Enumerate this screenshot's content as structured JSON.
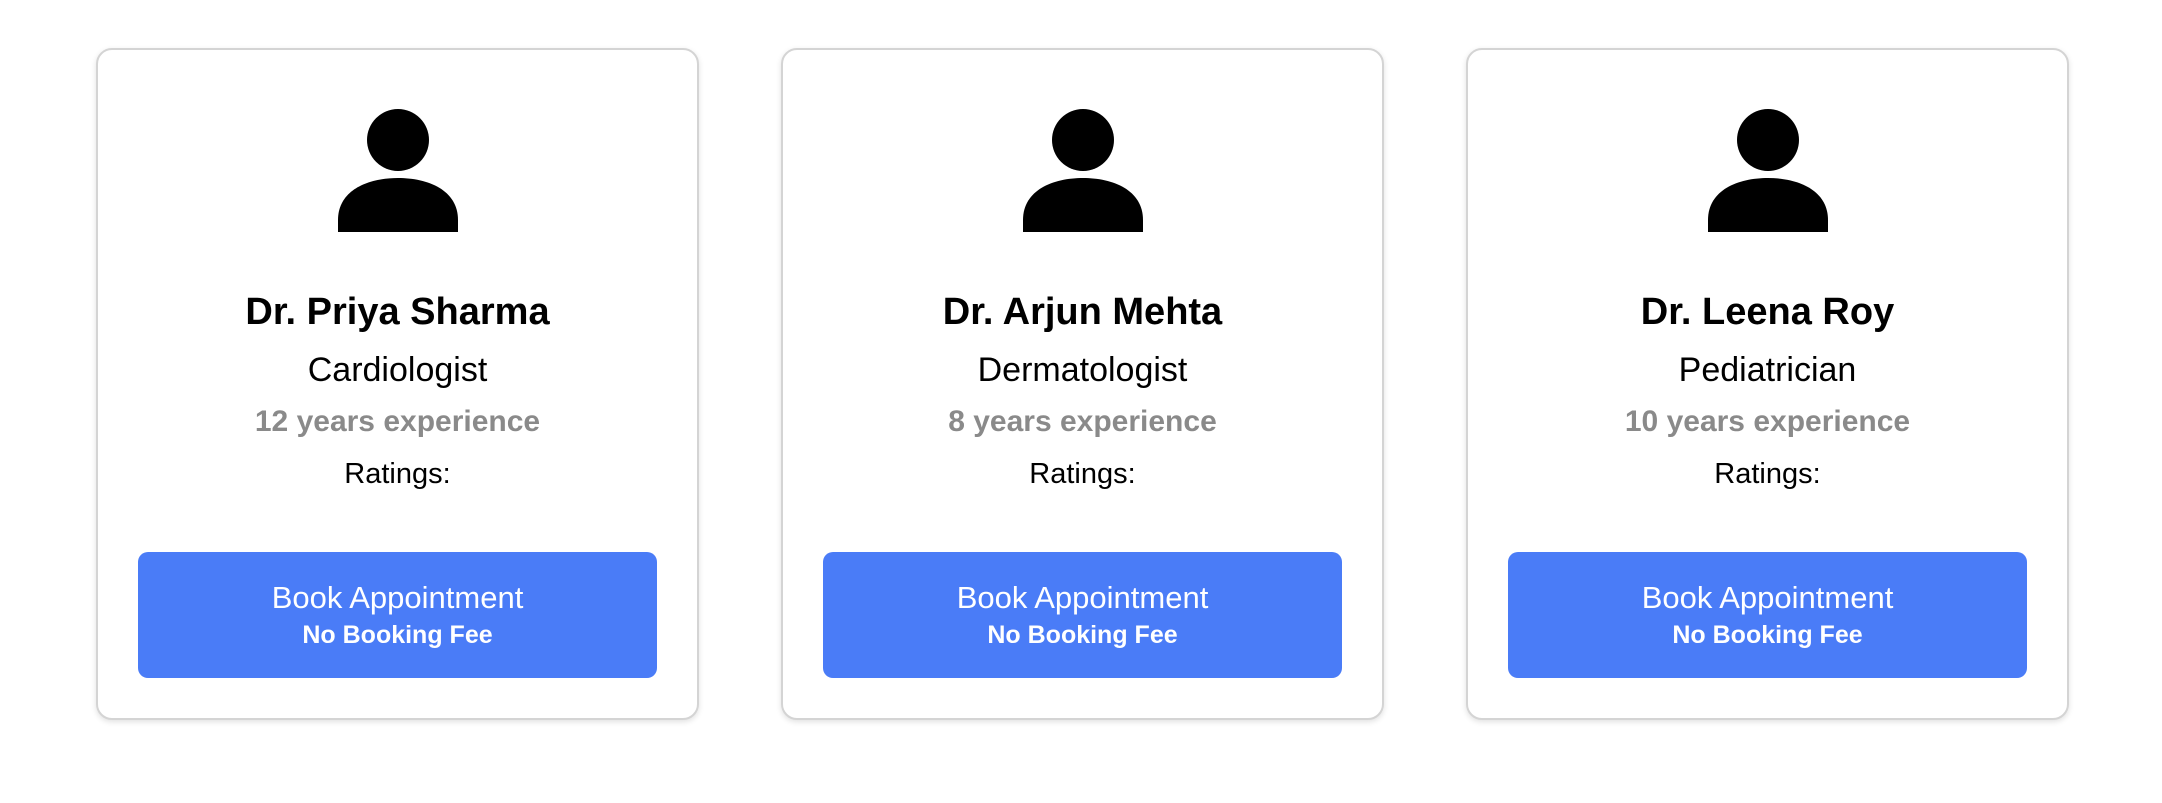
{
  "colors": {
    "button_bg": "#4a7cf7",
    "experience_text": "#8a8a8a",
    "card_border": "#d4d4d4"
  },
  "doctors": [
    {
      "avatar_icon": "user-icon",
      "name": "Dr. Priya Sharma",
      "specialty": "Cardiologist",
      "experience": "12 years experience",
      "ratings_label": "Ratings:",
      "button_label": "Book Appointment",
      "button_sublabel": "No Booking Fee"
    },
    {
      "avatar_icon": "user-icon",
      "name": "Dr. Arjun Mehta",
      "specialty": "Dermatologist",
      "experience": "8 years experience",
      "ratings_label": "Ratings:",
      "button_label": "Book Appointment",
      "button_sublabel": "No Booking Fee"
    },
    {
      "avatar_icon": "user-icon",
      "name": "Dr. Leena Roy",
      "specialty": "Pediatrician",
      "experience": "10 years experience",
      "ratings_label": "Ratings:",
      "button_label": "Book Appointment",
      "button_sublabel": "No Booking Fee"
    }
  ]
}
